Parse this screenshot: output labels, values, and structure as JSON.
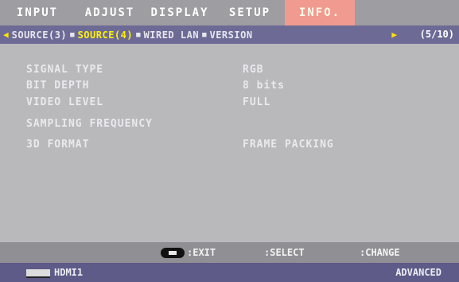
{
  "menu": {
    "tabs": [
      {
        "label": "INPUT"
      },
      {
        "label": "ADJUST"
      },
      {
        "label": "DISPLAY"
      },
      {
        "label": "SETUP"
      },
      {
        "label": "INFO."
      }
    ],
    "active_index": 4
  },
  "subtabs": {
    "items": [
      {
        "label": "SOURCE(3)"
      },
      {
        "label": "SOURCE(4)"
      },
      {
        "label": "WIRED LAN"
      },
      {
        "label": "VERSION"
      }
    ],
    "active_index": 1,
    "page": "(5/10)"
  },
  "info": {
    "rows": [
      {
        "label": "SIGNAL TYPE",
        "value": "RGB"
      },
      {
        "label": "BIT DEPTH",
        "value": "8 bits"
      },
      {
        "label": "VIDEO LEVEL",
        "value": "FULL"
      },
      {
        "label": "SAMPLING FREQUENCY",
        "value": ""
      },
      {
        "label": "3D FORMAT",
        "value": "FRAME PACKING"
      }
    ]
  },
  "help": {
    "exit": ":EXIT",
    "select": ":SELECT",
    "change": ":CHANGE"
  },
  "status": {
    "source": "HDMI1",
    "menu_mode": "ADVANCED"
  },
  "colors": {
    "menu_bar": "#9d9da2",
    "active_tab": "#f19a8f",
    "sub_bar": "#6d6b95",
    "active_subtab_text": "#fff200",
    "panel": "#b9b9bc",
    "help_bar": "#8f8f94",
    "status_bar": "#5e5b88"
  }
}
